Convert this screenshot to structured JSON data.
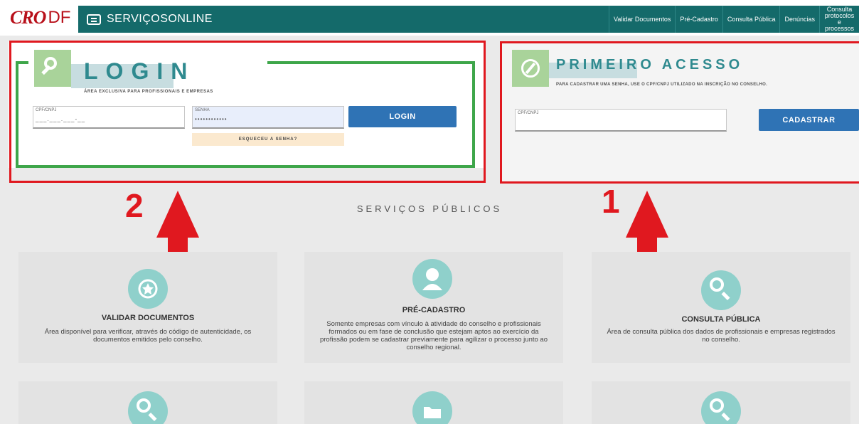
{
  "brand": {
    "logo_main": "CRO",
    "logo_suffix": "DF"
  },
  "header": {
    "app_title": "SERVIÇOSONLINE",
    "nav": [
      "Validar Documentos",
      "Pré-Cadastro",
      "Consulta Pública",
      "Denúncias"
    ],
    "nav_multi": [
      "Consulta protocolos",
      "e processos"
    ]
  },
  "login": {
    "title": "LOGIN",
    "subtitle": "ÁREA EXCLUSIVA PARA PROFISSIONAIS E EMPRESAS",
    "cpf_label": "CPF/CNPJ",
    "cpf_value": "___.___.___-__",
    "password_label": "SENHA",
    "password_value": "••••••••••••",
    "submit_label": "LOGIN",
    "forgot_label": "ESQUECEU A SENHA?"
  },
  "first_access": {
    "title": "PRIMEIRO ACESSO",
    "subtitle": "PARA CADASTRAR UMA SENHA, USE O CPF/CNPJ UTILIZADO NA INSCRIÇÃO NO CONSELHO.",
    "cpf_label": "CPF/CNPJ",
    "submit_label": "CADASTRAR"
  },
  "annotations": {
    "left_number": "2",
    "right_number": "1"
  },
  "services": {
    "section_title": "SERVIÇOS PÚBLICOS",
    "cards": [
      {
        "title": "VALIDAR DOCUMENTOS",
        "description": "Área disponível para verificar, através do código de autenticidade, os documentos emitidos pelo conselho.",
        "icon": "seal-icon"
      },
      {
        "title": "PRÉ-CADASTRO",
        "description": "Somente empresas com vínculo à atividade do conselho e profissionais formados ou em fase de conclusão que estejam aptos ao exercício da profissão podem se cadastrar previamente para agilizar o processo junto ao conselho regional.",
        "icon": "user-icon"
      },
      {
        "title": "CONSULTA PÚBLICA",
        "description": "Área de consulta pública dos dados de profissionais e empresas registrados no conselho.",
        "icon": "search-icon"
      }
    ]
  },
  "colors": {
    "brand_red": "#b8101a",
    "nav_teal": "#146a6a",
    "accent_blue": "#2f73b5",
    "highlight_red": "#e0181f",
    "highlight_green": "#3ea64a",
    "icon_teal": "#8fd0cb"
  }
}
